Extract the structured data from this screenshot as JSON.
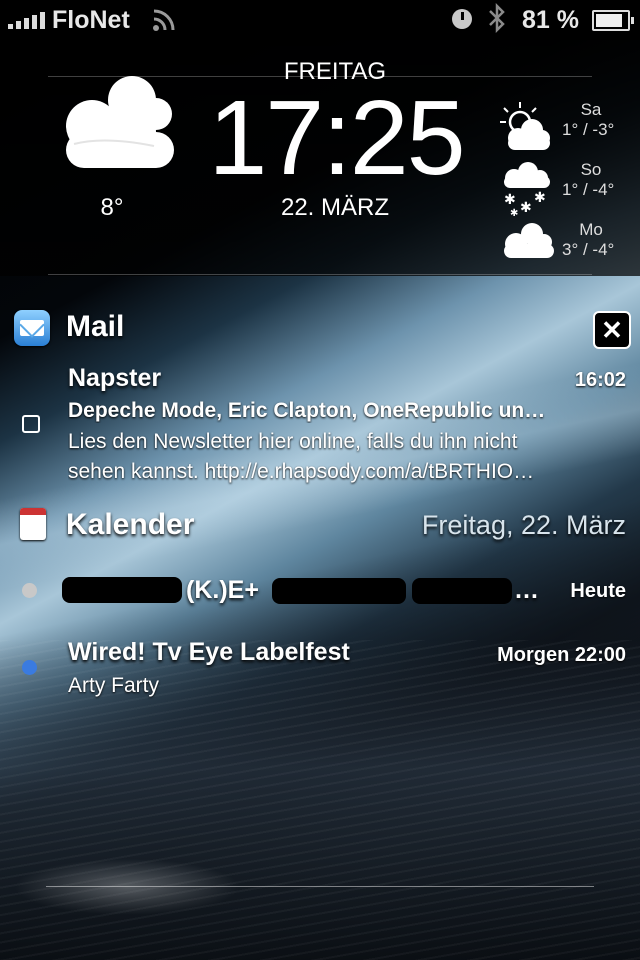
{
  "status_bar": {
    "carrier": "FloNet",
    "battery_percent": "81 %",
    "signal_bars": 5,
    "icons": [
      "signal-icon",
      "wifi-icon",
      "clock-icon",
      "bluetooth-icon",
      "battery-icon"
    ]
  },
  "widget": {
    "day": "FREITAG",
    "time": "17:25",
    "date": "22. MÄRZ",
    "current_temp": "8°",
    "current_icon": "cloudy-icon",
    "forecast": [
      {
        "day": "Sa",
        "temps": "1° / -3°",
        "icon": "partly-sunny-icon"
      },
      {
        "day": "So",
        "temps": "1° / -4°",
        "icon": "snow-icon"
      },
      {
        "day": "Mo",
        "temps": "3° / -4°",
        "icon": "cloudy-icon"
      }
    ]
  },
  "mail": {
    "section_title": "Mail",
    "close_label": "✕",
    "message": {
      "sender": "Napster",
      "time": "16:02",
      "subject": "Depeche Mode, Eric Clapton, OneRepublic un…",
      "body_line1": "Lies den Newsletter hier online, falls du ihn nicht",
      "body_line2": "sehen kannst. http://e.rhapsody.com/a/tBRTHIO…"
    }
  },
  "calendar": {
    "section_title": "Kalender",
    "date_label": "Freitag, 22. März",
    "events": [
      {
        "title_visible": "(K.)E+",
        "ellipsis": "…",
        "when": "Heute",
        "dot_color": "#c8c8c8",
        "redacted": true
      },
      {
        "title": "Wired! Tv Eye Labelfest",
        "location": "Arty Farty",
        "when": "Morgen 22:00",
        "dot_color": "#3a7be0"
      }
    ]
  },
  "colors": {
    "background_dark": "#05070a",
    "event_dot_blue": "#3a7be0",
    "event_dot_gray": "#c8c8c8"
  }
}
